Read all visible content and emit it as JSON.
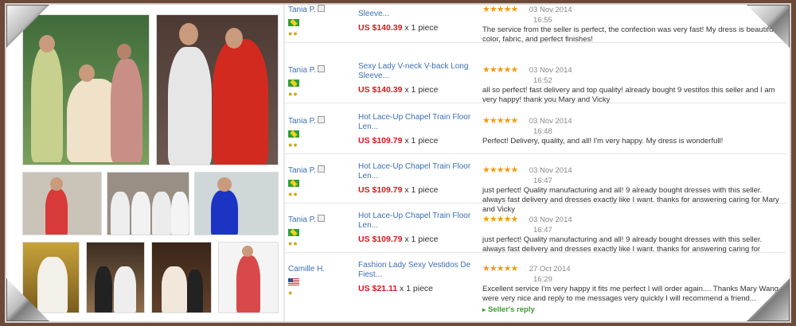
{
  "reviews": [
    {
      "user": "Tania P.",
      "country": "br",
      "product": "Sleeve...",
      "price": "US $140.39",
      "qty": "x 1 piece",
      "stars": "★★★★★",
      "date": "03 Nov 2014",
      "time": "16:55",
      "text": "The service from the seller is perfect, the confection was very fast! My dress is beautiful, color, fabric, and perfect finishes!"
    },
    {
      "user": "Tania P.",
      "country": "br",
      "product": "Sexy Lady V-neck V-back Long Sleeve...",
      "price": "US $140.39",
      "qty": "x 1 piece",
      "stars": "★★★★★",
      "date": "03 Nov 2014",
      "time": "16:52",
      "text": "all so perfect! fast delivery and top quality! already bought 9 vestifos this seller and I am very happy! thank you Mary and Vicky"
    },
    {
      "user": "Tania P.",
      "country": "br",
      "product": "Hot Lace-Up Chapel Train Floor Len...",
      "price": "US $109.79",
      "qty": "x 1 piece",
      "stars": "★★★★★",
      "date": "03 Nov 2014",
      "time": "16:48",
      "text": "Perfect! Delivery, quality, and all! I'm very happy. My dress is wonderfull!"
    },
    {
      "user": "Tania P.",
      "country": "br",
      "product": "Hot Lace-Up Chapel Train Floor Len...",
      "price": "US $109.79",
      "qty": "x 1 piece",
      "stars": "★★★★★",
      "date": "03 Nov 2014",
      "time": "16:47",
      "text": "just perfect! Quality manufacturing and all! 9 already bought dresses with this seller. always fast delivery and dresses exactly like I want. thanks for answering caring for Mary and Vicky"
    },
    {
      "user": "Tania P.",
      "country": "br",
      "product": "Hot Lace-Up Chapel Train Floor Len...",
      "price": "US $109.79",
      "qty": "x 1 piece",
      "stars": "★★★★★",
      "date": "03 Nov 2014",
      "time": "16:47",
      "text": "just perfect! Quality manufacturing and all! 9 already bought dresses with this seller. always fast delivery and dresses exactly like I want. thanks for answering caring for"
    },
    {
      "user": "Camille H.",
      "country": "us",
      "product": "Fashion Lady Sexy Vestidos De Fiest...",
      "price": "US $21.11",
      "qty": "x 1 piece",
      "stars": "★★★★★",
      "date": "27 Oct 2014",
      "time": "16:29",
      "text": "Excellent service I'm very happy it fits me perfect I will order again.... Thanks Mary Wang u were very nice and reply to me messages very quickly I will recommend a friend...",
      "reply_label": "Seller's reply"
    }
  ],
  "colors": {
    "link": "#3b6fb6",
    "price": "#d71920",
    "stars": "#f39c12",
    "reply": "#3c9a2f"
  }
}
